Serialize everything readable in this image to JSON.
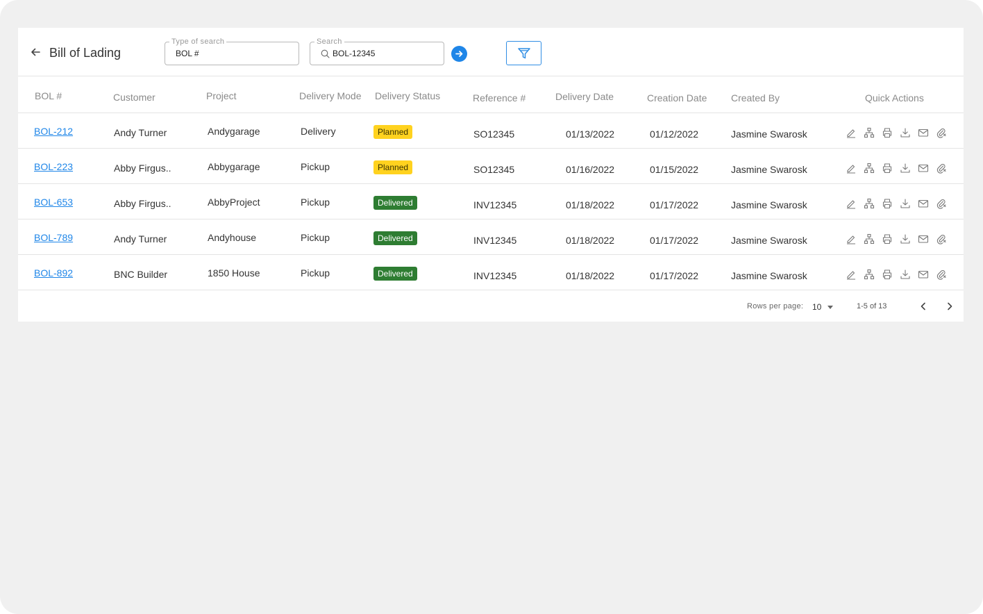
{
  "header": {
    "title": "Bill of Lading",
    "type_of_search": {
      "legend": "Type of search",
      "value": "BOL #"
    },
    "search": {
      "legend": "Search",
      "value": "BOL-12345"
    }
  },
  "colors": {
    "accent": "#1f86e8",
    "planned": "#ffd21f",
    "delivered": "#2e7d32"
  },
  "table": {
    "columns": [
      "BOL #",
      "Customer",
      "Project",
      "Delivery Mode",
      "Delivery Status",
      "Reference #",
      "Delivery Date",
      "Creation Date",
      "Created By",
      "Quick Actions"
    ],
    "quick_action_icons": [
      "edit-icon",
      "hierarchy-icon",
      "print-icon",
      "download-icon",
      "mail-icon",
      "attachment-icon"
    ],
    "rows": [
      {
        "bol": "BOL-212",
        "customer": "Andy Turner",
        "project": "Andygarage",
        "mode": "Delivery",
        "status": "Planned",
        "reference": "SO12345",
        "delivery_date": "01/13/2022",
        "creation_date": "01/12/2022",
        "created_by": "Jasmine Swarosk"
      },
      {
        "bol": "BOL-223",
        "customer": "Abby Firgus..",
        "project": "Abbygarage",
        "mode": "Pickup",
        "status": "Planned",
        "reference": "SO12345",
        "delivery_date": "01/16/2022",
        "creation_date": "01/15/2022",
        "created_by": "Jasmine Swarosk"
      },
      {
        "bol": "BOL-653",
        "customer": "Abby Firgus..",
        "project": "AbbyProject",
        "mode": "Pickup",
        "status": "Delivered",
        "reference": "INV12345",
        "delivery_date": "01/18/2022",
        "creation_date": "01/17/2022",
        "created_by": "Jasmine Swarosk"
      },
      {
        "bol": "BOL-789",
        "customer": "Andy Turner",
        "project": "Andyhouse",
        "mode": "Pickup",
        "status": "Delivered",
        "reference": "INV12345",
        "delivery_date": "01/18/2022",
        "creation_date": "01/17/2022",
        "created_by": "Jasmine Swarosk"
      },
      {
        "bol": "BOL-892",
        "customer": "BNC Builder",
        "project": "1850 House",
        "mode": "Pickup",
        "status": "Delivered",
        "reference": "INV12345",
        "delivery_date": "01/18/2022",
        "creation_date": "01/17/2022",
        "created_by": "Jasmine Swarosk"
      }
    ]
  },
  "pagination": {
    "rows_per_page_label": "Rows per page:",
    "rows_per_page": "10",
    "range": "1-5 of 13"
  }
}
